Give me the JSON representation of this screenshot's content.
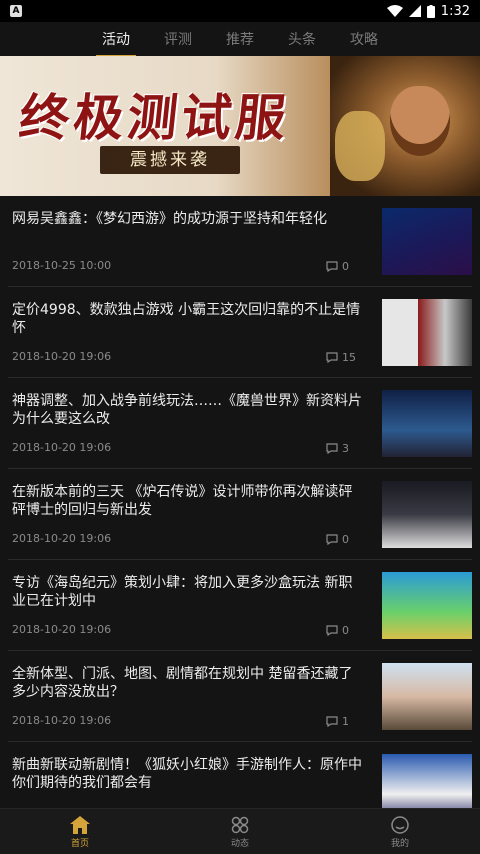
{
  "status": {
    "time": "1:32",
    "app_indicator": "A"
  },
  "tabs": [
    {
      "label": "活动",
      "active": true
    },
    {
      "label": "评测",
      "active": false
    },
    {
      "label": "推荐",
      "active": false
    },
    {
      "label": "头条",
      "active": false
    },
    {
      "label": "攻略",
      "active": false
    }
  ],
  "banner": {
    "title": "终极测试服",
    "subtitle": "震撼来袭"
  },
  "articles": [
    {
      "title": "网易吴鑫鑫：《梦幻西游》的成功源于坚持和年轻化",
      "date": "2018-10-25 10:00",
      "comments": "0"
    },
    {
      "title": "定价4998、数款独占游戏 小霸王这次回归靠的不止是情怀",
      "date": "2018-10-20 19:06",
      "comments": "15"
    },
    {
      "title": "神器调整、加入战争前线玩法……《魔兽世界》新资料片为什么要这么改",
      "date": "2018-10-20 19:06",
      "comments": "3"
    },
    {
      "title": "在新版本前的三天 《炉石传说》设计师带你再次解读砰砰博士的回归与新出发",
      "date": "2018-10-20 19:06",
      "comments": "0"
    },
    {
      "title": "专访《海岛纪元》策划小肆：将加入更多沙盒玩法 新职业已在计划中",
      "date": "2018-10-20 19:06",
      "comments": "0"
    },
    {
      "title": "全新体型、门派、地图、剧情都在规划中 楚留香还藏了多少内容没放出？",
      "date": "2018-10-20 19:06",
      "comments": "1"
    },
    {
      "title": "新曲新联动新剧情！《狐妖小红娘》手游制作人：原作中你们期待的我们都会有",
      "date": "",
      "comments": ""
    }
  ],
  "bottom_nav": [
    {
      "label": "首页",
      "active": true
    },
    {
      "label": "动态",
      "active": false
    },
    {
      "label": "我的",
      "active": false
    }
  ],
  "colors": {
    "accent": "#d4a43a",
    "background": "#141414"
  }
}
